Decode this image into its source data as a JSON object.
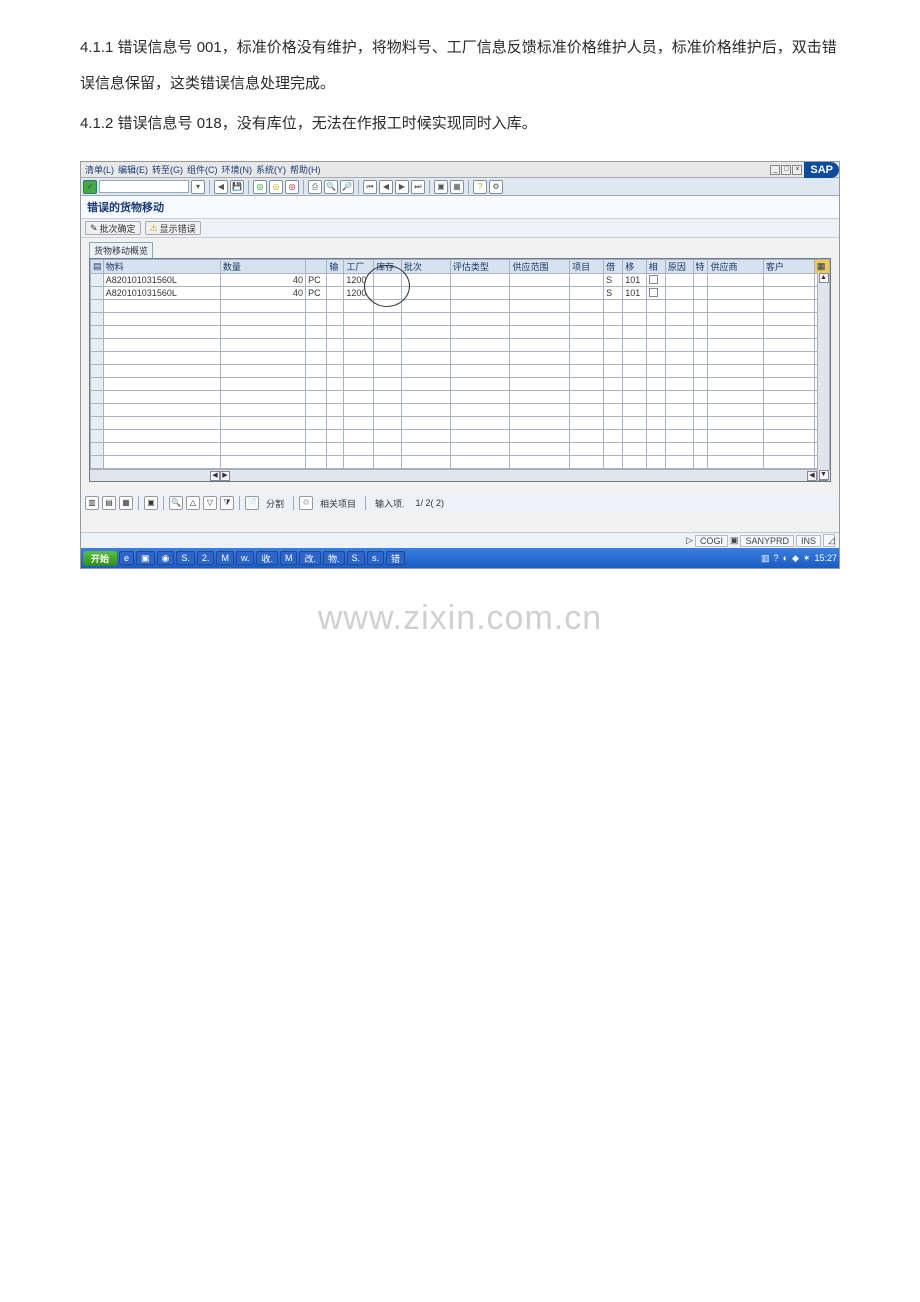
{
  "doc": {
    "p1": "4.1.1 错误信息号 001，标准价格没有维护，将物料号、工厂信息反馈标准价格维护人员，标准价格维护后，双击错误信息保留，这类错误信息处理完成。",
    "p2": "4.1.2 错误信息号 018，没有库位，无法在作报工时候实现同时入库。"
  },
  "menu": [
    "清单(L)",
    "编辑(E)",
    "转至(G)",
    "组件(C)",
    "环境(N)",
    "系统(Y)",
    "帮助(H)"
  ],
  "logo": "SAP",
  "title": "错误的货物移动",
  "subtoolbar": {
    "batch": "批次确定",
    "errors": "显示错误"
  },
  "panel_title": "货物移动概览",
  "columns": [
    "",
    "物料",
    "数量",
    "",
    "输",
    "工厂",
    "库存",
    "批次",
    "评估类型",
    "供应范围",
    "项目",
    "借",
    "移",
    "相",
    "原因",
    "特",
    "供应商",
    "客户",
    ""
  ],
  "rows": [
    {
      "material": "A820101031560L",
      "qty": "40",
      "unit": "PC",
      "plant": "1200",
      "deb": "S",
      "mov": "101"
    },
    {
      "material": "A820101031560L",
      "qty": "40",
      "unit": "PC",
      "plant": "1200",
      "deb": "S",
      "mov": "101"
    }
  ],
  "footbar": {
    "split": "分割",
    "related": "相关项目",
    "input": "输入项.",
    "count": "1/ 2( 2)"
  },
  "status": {
    "tri": "▷",
    "a": "COGI",
    "ic": "▣",
    "b": "SANYPRD",
    "c": "INS"
  },
  "taskbar": {
    "start": "开始",
    "items": [
      "S.",
      "2.",
      "M",
      "w.",
      "收.",
      "M",
      "改.",
      "物.",
      "S.",
      "s.",
      "错"
    ],
    "time": "15:27"
  },
  "watermark": "www.zixin.com.cn"
}
